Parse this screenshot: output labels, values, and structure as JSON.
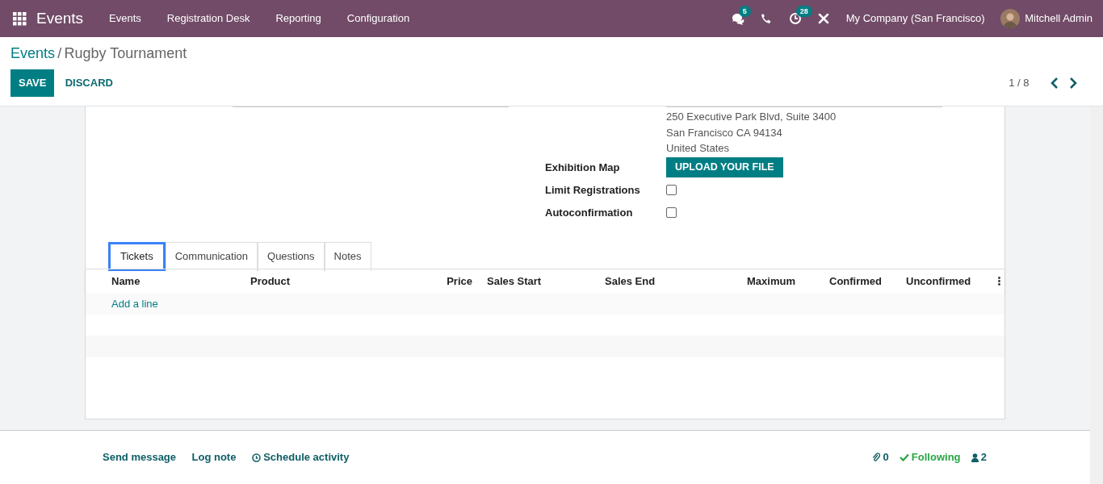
{
  "navbar": {
    "app": "Events",
    "menu": [
      "Events",
      "Registration Desk",
      "Reporting",
      "Configuration"
    ],
    "messages_count": "5",
    "activities_count": "28",
    "company": "My Company (San Francisco)",
    "user": "Mitchell Admin"
  },
  "breadcrumb": {
    "parent": "Events",
    "separator": "/",
    "current": "Rugby Tournament"
  },
  "save_button": "SAVE",
  "discard_button": "DISCARD",
  "pager": "1 / 8",
  "form": {
    "address_lines": [
      "250 Executive Park Blvd, Suite 3400",
      "San Francisco CA 94134",
      "United States"
    ],
    "fields": [
      {
        "label": "Exhibition Map",
        "kind": "upload",
        "button": "UPLOAD YOUR FILE"
      },
      {
        "label": "Limit Registrations",
        "kind": "checkbox",
        "checked": false
      },
      {
        "label": "Autoconfirmation",
        "kind": "checkbox",
        "checked": false
      }
    ]
  },
  "tabs": [
    {
      "label": "Tickets",
      "selected": true
    },
    {
      "label": "Communication",
      "selected": false
    },
    {
      "label": "Questions",
      "selected": false
    },
    {
      "label": "Notes",
      "selected": false
    }
  ],
  "table": {
    "columns": [
      "Name",
      "Product",
      "Price",
      "Sales Start",
      "Sales End",
      "Maximum",
      "Confirmed",
      "Unconfirmed"
    ],
    "add_line": "Add a line"
  },
  "chatter": {
    "actions": [
      {
        "label": "Send message",
        "kind": "message"
      },
      {
        "label": "Log note",
        "kind": "note"
      },
      {
        "label": "Schedule activity",
        "kind": "activity"
      }
    ],
    "attachments": "0",
    "follow": "Following",
    "followers": "2"
  }
}
